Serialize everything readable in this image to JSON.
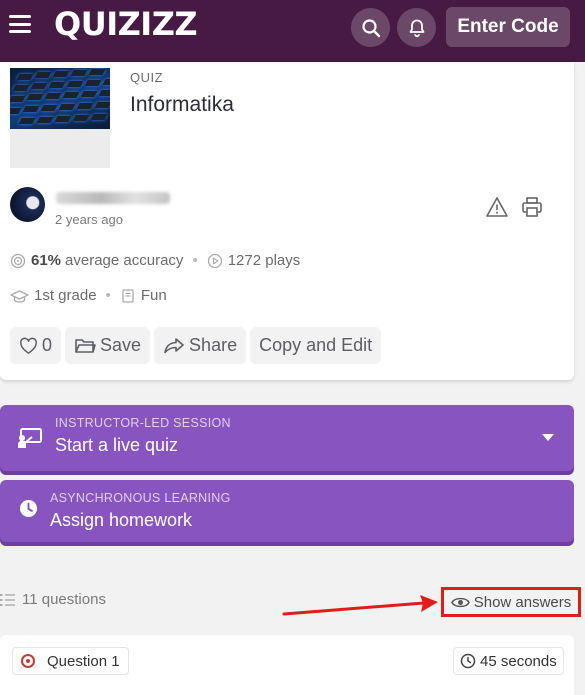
{
  "header": {
    "logo_text": "QUIZIZZ",
    "enter_code_label": "Enter Code",
    "background": "#461a42"
  },
  "quiz": {
    "type_label": "QUIZ",
    "title": "Informatika",
    "time_ago": "2 years ago",
    "accuracy_value": "61%",
    "accuracy_label": "average accuracy",
    "plays": "1272 plays",
    "grade": "1st grade",
    "subject": "Fun"
  },
  "actions": {
    "like_count": "0",
    "save_label": "Save",
    "share_label": "Share",
    "copy_edit_label": "Copy and Edit"
  },
  "live": {
    "label": "INSTRUCTOR-LED SESSION",
    "title": "Start a live quiz"
  },
  "homework": {
    "label": "ASYNCHRONOUS LEARNING",
    "title": "Assign homework"
  },
  "questions": {
    "count_label": "11 questions",
    "show_answers_label": "Show answers",
    "first": {
      "label": "Question 1",
      "time": "45 seconds"
    }
  },
  "colors": {
    "accent": "#8854c0",
    "highlight": "#e21b1b"
  }
}
